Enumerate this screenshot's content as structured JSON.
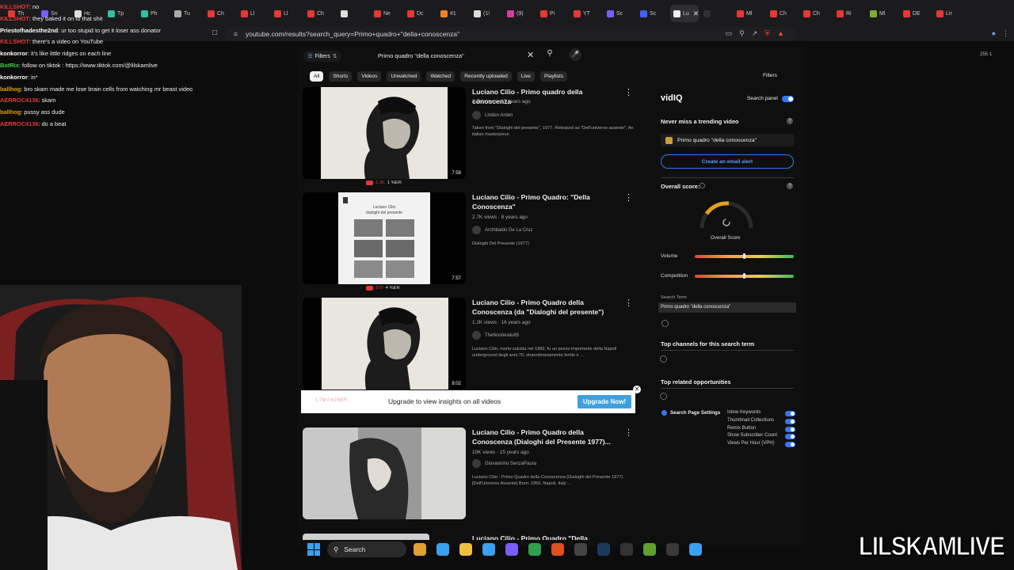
{
  "browser": {
    "tabs": [
      {
        "label": "Th",
        "color": "#e53935"
      },
      {
        "label": "Sn",
        "color": "#7a5cff"
      },
      {
        "label": "Hc",
        "color": "#dddddd"
      },
      {
        "label": "Tp",
        "color": "#30c0a0"
      },
      {
        "label": "Ph",
        "color": "#30c0a0"
      },
      {
        "label": "Tu",
        "color": "#aaaaaa"
      },
      {
        "label": "Ch",
        "color": "#e53935"
      },
      {
        "label": "Ll",
        "color": "#e53935"
      },
      {
        "label": "Ll",
        "color": "#e53935"
      },
      {
        "label": "Ch",
        "color": "#e53935"
      },
      {
        "label": "",
        "color": "#dddddd"
      },
      {
        "label": "Ne",
        "color": "#e53935"
      },
      {
        "label": "Dc",
        "color": "#e53935"
      },
      {
        "label": "#1",
        "color": "#f08020"
      },
      {
        "label": "(1!",
        "color": "#dddddd"
      },
      {
        "label": "(9)",
        "color": "#d040a0"
      },
      {
        "label": "Pi",
        "color": "#e53935"
      },
      {
        "label": "YT",
        "color": "#e53935"
      },
      {
        "label": "Sc",
        "color": "#7a5cff"
      },
      {
        "label": "Sc",
        "color": "#4060ff"
      },
      {
        "label": "Lu",
        "color": "#eeeeee"
      },
      {
        "label": "",
        "color": "#2f2f33"
      },
      {
        "label": "Ml",
        "color": "#e53935"
      },
      {
        "label": "Ch",
        "color": "#e53935"
      },
      {
        "label": "Ch",
        "color": "#e53935"
      },
      {
        "label": "Ri",
        "color": "#e53935"
      },
      {
        "label": "Ml",
        "color": "#7ab030"
      },
      {
        "label": "DE",
        "color": "#e53935"
      },
      {
        "label": "Lir",
        "color": "#e53935"
      }
    ],
    "url": "youtube.com/results?search_query=Primo+quadro+\"della+conoscenza\""
  },
  "chat": [
    {
      "user": "KILLSHOT",
      "color": "#e53935",
      "msg": ": no"
    },
    {
      "user": "KILLSHOT",
      "color": "#e53935",
      "msg": ": they baked it on to that shit"
    },
    {
      "user": "Priestofhadesthe2nd",
      "color": "#ffffff",
      "msg": ": ur too stupid to get it loser ass donator"
    },
    {
      "user": "KILLSHOT",
      "color": "#e53935",
      "msg": ": there's a video on YouTube"
    },
    {
      "user": "konkorror",
      "color": "#ffffff",
      "msg": ": it's like little ridges on each line"
    },
    {
      "user": "BotRix",
      "color": "#40d040",
      "msg": ": follow on tiktok : https://www.tiktok.com/@lilskamlive"
    },
    {
      "user": "konkorror",
      "color": "#ffffff",
      "msg": ": in*"
    },
    {
      "user": "ballhog",
      "color": "#e0a000",
      "msg": ": bro skam made me lose brain cells from watching mr beast video"
    },
    {
      "user": "AERROC4136",
      "color": "#e53935",
      "msg": ": skam"
    },
    {
      "user": "ballhog",
      "color": "#e0a000",
      "msg": ": pussy ass dude"
    },
    {
      "user": "AERROC4136",
      "color": "#e53935",
      "msg": ": do a beat"
    }
  ],
  "youtube": {
    "filters_label": "Filters",
    "search_value": "Primo quadro \"della conoscenza\"",
    "chips": [
      "All",
      "Shorts",
      "Videos",
      "Unwatched",
      "Watched",
      "Recently uploaded",
      "Live",
      "Playlists"
    ],
    "videos": [
      {
        "title": "Luciano Cilio - Primo quadro della conoscenza",
        "meta": "1.7K views · 17 years ago",
        "channel": "Linden Arden",
        "desc": "Taken from \"Dialoghi del presente\", 1977. Released as \"Dell'universo assente\". An italian masterpiece.",
        "duration": "7:58",
        "stat1": "1.3K",
        "stat2": "1 %ER"
      },
      {
        "title": "Luciano Cilio - Primo Quadro: \"Della Conoscenza\"",
        "meta": "2.7K views · 8 years ago",
        "channel": "Archibaldo De La Cruz",
        "desc": "Dialoghi Del Presente (1977)",
        "duration": "7:57",
        "stat1": "150",
        "stat2": "4 %ER"
      },
      {
        "title": "Luciano Cilio - Primo Quadro della Conoscenza (da \"Dialoghi del presente\")",
        "meta": "1.2K views · 16 years ago",
        "channel": "TheNosferatu65",
        "desc": "Luciano Cilio, morto suicida nel 1983, fu un pezzo importante della Napoli underground degli anni 70, straordinariamente fertile e ...",
        "duration": "8:02",
        "stat1": "",
        "stat2": ""
      },
      {
        "title": "Luciano Cilio - Primo Quadro della Conoscenza (Dialoghi del Presente 1977)...",
        "meta": "10K views · 15 years ago",
        "channel": "Giovannino SenzaPaura",
        "desc": "Luciano Cilio - Primo Quadro della Conoscenza (Dialoghi del Presente 1977) [Dell'Universo Assente] Born: 1950, Napoli, Italy ...",
        "duration": "",
        "stat1": "",
        "stat2": ""
      }
    ],
    "partial_title": "Luciano Cilio - Primo Quadro \"Della"
  },
  "upgrade": {
    "faded": "1.7M  0.61%ER",
    "text": "Upgrade to view insights on all videos",
    "button": "Upgrade Now!"
  },
  "vidiq": {
    "filters": "Filters",
    "logo": "vidIQ",
    "search_panel": "Search panel",
    "trending_head": "Never miss a trending video",
    "alert_term": "Primo quadro \"della conoscenza\"",
    "create_alert": "Create an email alert",
    "score_head": "Overall score:",
    "overall_score": "Overall Score",
    "volume": "Volume",
    "competition": "Competition",
    "search_term_label": "Search Term",
    "search_term": "Primo quadro \"della conoscenza\"",
    "top_channels": "Top channels for this search term",
    "top_related": "Top related opportunities",
    "settings_label": "Search Page Settings",
    "options": [
      "Inline Keywords",
      "Thumbnail Collections",
      "Remix Button",
      "Show Subscriber Count",
      "Views Per Hour (VPH)"
    ],
    "volume_level": 0.5,
    "competition_level": 0.5
  },
  "taskbar": {
    "search": "Search",
    "apps": [
      {
        "name": "files-icon",
        "color": "#e0a030"
      },
      {
        "name": "copilot-icon",
        "color": "#3aa0f0"
      },
      {
        "name": "folder-icon",
        "color": "#f0c040"
      },
      {
        "name": "store-icon",
        "color": "#3aa0f0"
      },
      {
        "name": "discord-icon",
        "color": "#7a5cff"
      },
      {
        "name": "app-green-icon",
        "color": "#30a050"
      },
      {
        "name": "brave-icon",
        "color": "#e05020"
      },
      {
        "name": "obs-icon",
        "color": "#444444"
      },
      {
        "name": "steam-icon",
        "color": "#1b3a5a"
      },
      {
        "name": "app-bar-icon",
        "color": "#333333"
      },
      {
        "name": "xbox-icon",
        "color": "#60a030"
      },
      {
        "name": "4k-icon",
        "color": "#3a3a3a"
      },
      {
        "name": "notepad-icon",
        "color": "#3aa0f0"
      }
    ]
  },
  "topright": "255  1",
  "watermark": "LILSKAMLIVE"
}
